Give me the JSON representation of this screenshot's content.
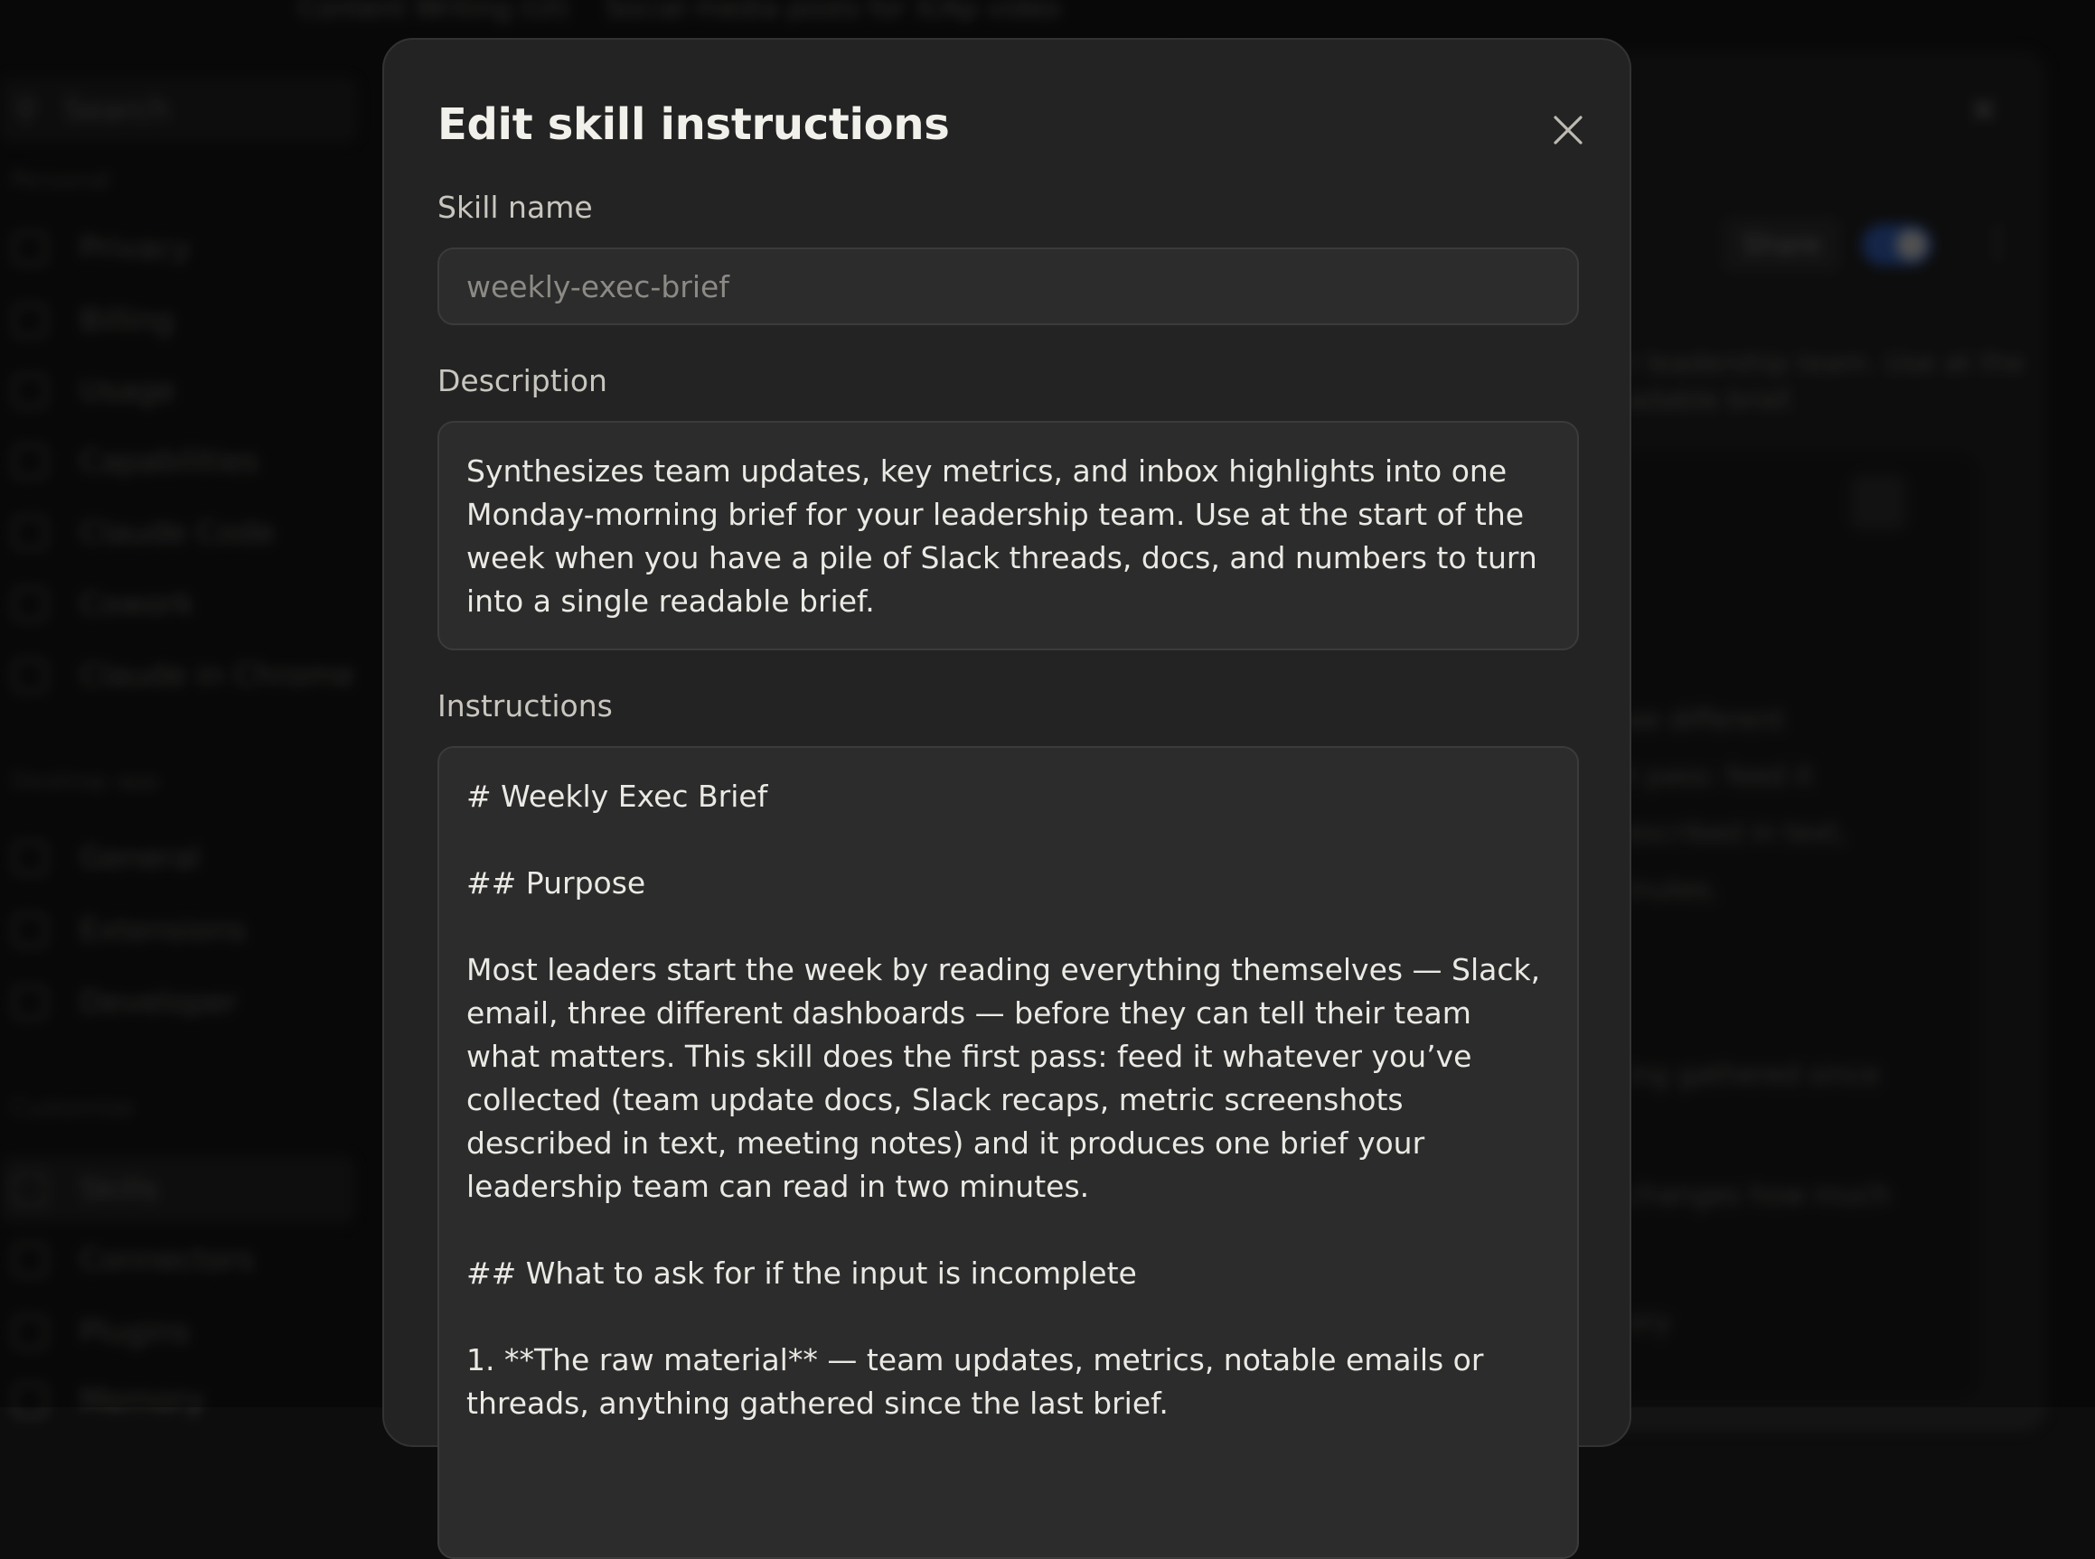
{
  "background": {
    "topbar": [
      "Content Writing (UI)",
      "Social media posts for X/Ap video"
    ],
    "search_placeholder": "Search",
    "sidebar_groups": [
      {
        "label": "Personal",
        "items": [
          "Privacy",
          "Billing",
          "Usage",
          "Capabilities",
          "Claude Code",
          "Cowork",
          "Claude in Chrome"
        ]
      },
      {
        "label": "Desktop app",
        "items": [
          "General",
          "Extensions",
          "Developer"
        ]
      },
      {
        "label": "Customize",
        "items": [
          "Skills",
          "Connectors",
          "Plugins",
          "Memory"
        ]
      }
    ],
    "share_label": "Share",
    "panel_lines": [
      "r leadership team. Use at the",
      "adable brief.",
      "ee different",
      "t pass: feed it",
      "escribed in text,",
      "inutes.",
      "ing gathered since",
      "changes how much",
      "ory"
    ]
  },
  "modal": {
    "title": "Edit skill instructions",
    "close_icon": "close-icon",
    "skill_name_label": "Skill name",
    "skill_name_value": "weekly-exec-brief",
    "description_label": "Description",
    "description_value": "Synthesizes team updates, key metrics, and inbox highlights into one Monday-morning brief for your leadership team. Use at the start of the week when you have a pile of Slack threads, docs, and numbers to turn into a single readable brief.",
    "instructions_label": "Instructions",
    "instructions_lines": [
      "# Weekly Exec Brief",
      "",
      "## Purpose",
      "",
      "Most leaders start the week by reading everything themselves — Slack, email, three different dashboards — before they can tell their team what matters. This skill does the first pass: feed it whatever you’ve collected (team update docs, Slack recaps, metric screenshots described in text, meeting notes) and it produces one brief your leadership team can read in two minutes.",
      "",
      "## What to ask for if the input is incomplete",
      "",
      "1. **The raw material** — team updates, metrics, notable emails or threads, anything gathered since the last brief."
    ]
  }
}
